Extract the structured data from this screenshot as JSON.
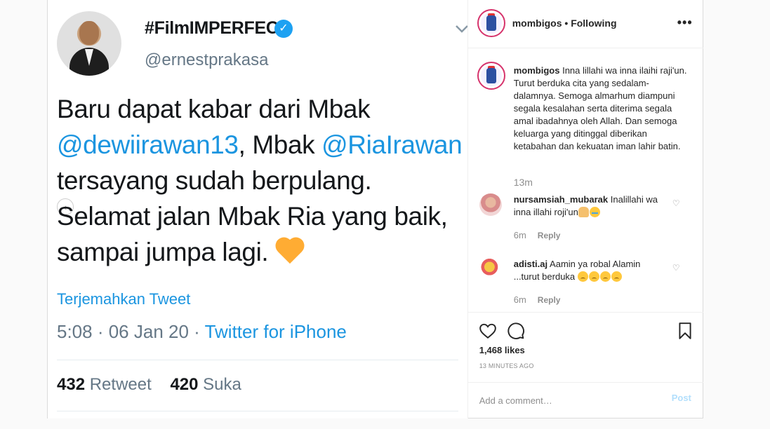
{
  "tweet": {
    "name": "#FilmIMPERFECT",
    "handle": "@ernestprakasa",
    "body_1": "Baru dapat kabar dari Mbak",
    "mention_1": "@dewiirawan13",
    "body_2": ", Mbak ",
    "mention_2": "@RiaIrawan",
    "body_3": "tersayang sudah berpulang.",
    "body_4": "Selamat jalan Mbak Ria yang baik,",
    "body_5": "sampai jumpa lagi.",
    "translate": "Terjemahkan Tweet",
    "meta_time": "5:08 · 06 Jan 20 · ",
    "meta_source": "Twitter for iPhone",
    "retweets": "432",
    "retweets_label": " Retweet",
    "likes": "420",
    "likes_label": " Suka"
  },
  "header": {
    "username": "mombigos",
    "separator": " • ",
    "follow_status": "Following"
  },
  "caption": {
    "username": "mombigos",
    "text": "Inna lillahi wa inna ilaihi raji'un. Turut berduka cita yang sedalam-dalamnya. Semoga almarhum diampuni segala kesalahan serta diterima segala amal ibadahnya oleh Allah. Dan semoga keluarga yang ditinggal diberikan ketabahan dan kekuatan iman lahir batin.",
    "time": "13m"
  },
  "comments": [
    {
      "username": "nursamsiah_mubarak",
      "text": "Inalillahi wa inna illahi roji'un",
      "time": "6m",
      "reply": "Reply"
    },
    {
      "username": "adisti.aj",
      "text": "Aamin ya robal Alamin ...turut berduka",
      "time": "6m",
      "reply": "Reply"
    }
  ],
  "actions": {
    "likes": "1,468 likes",
    "ago": "13 MINUTES AGO"
  },
  "add_comment": {
    "placeholder": "Add a comment…",
    "post_label": "Post"
  },
  "icons": {
    "heart": "heart-icon",
    "comment": "comment-icon",
    "save": "bookmark-icon",
    "more": "more-options-icon",
    "verified": "verified-badge-icon",
    "chevron": "chevron-down-icon"
  }
}
